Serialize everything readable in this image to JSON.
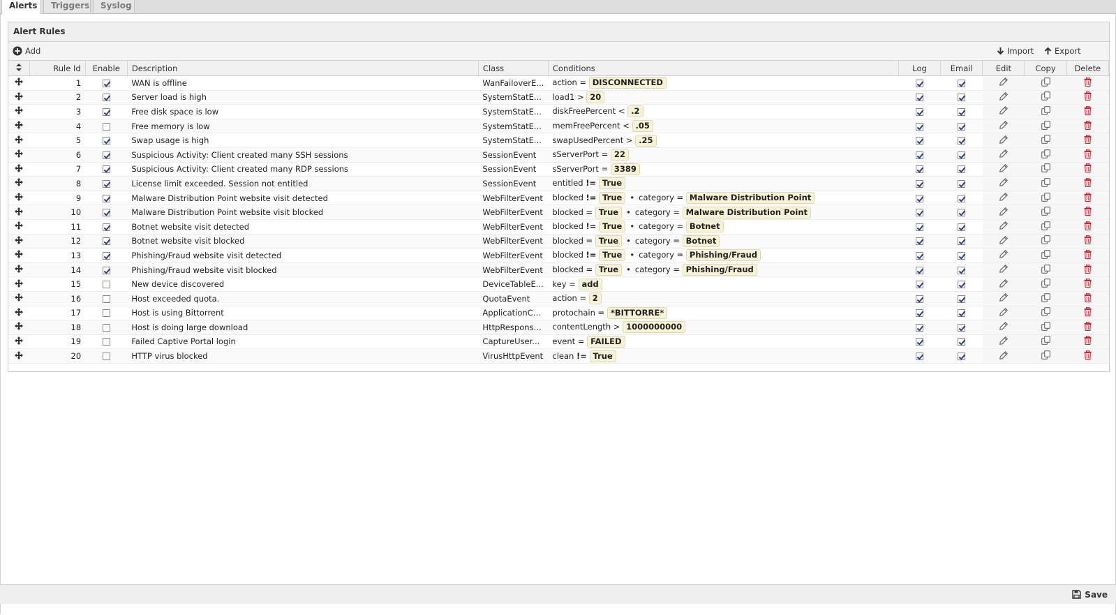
{
  "tabs": [
    {
      "label": "Alerts",
      "active": true
    },
    {
      "label": "Triggers",
      "active": false
    },
    {
      "label": "Syslog",
      "active": false
    }
  ],
  "panel": {
    "title": "Alert Rules"
  },
  "toolbar": {
    "add_label": "Add",
    "import_label": "Import",
    "export_label": "Export"
  },
  "columns": [
    "Rule Id",
    "Enable",
    "Description",
    "Class",
    "Conditions",
    "Log",
    "Email",
    "Edit",
    "Copy",
    "Delete"
  ],
  "rows": [
    {
      "id": "1",
      "enable": true,
      "description": "WAN is offline",
      "class": "WanFailoverE...",
      "conditions": [
        {
          "field": "action",
          "op": "=",
          "value": "DISCONNECTED"
        }
      ],
      "log": true,
      "email": true
    },
    {
      "id": "2",
      "enable": true,
      "description": "Server load is high",
      "class": "SystemStatE...",
      "conditions": [
        {
          "field": "load1",
          "op": ">",
          "value": "20"
        }
      ],
      "log": true,
      "email": true
    },
    {
      "id": "3",
      "enable": true,
      "description": "Free disk space is low",
      "class": "SystemStatE...",
      "conditions": [
        {
          "field": "diskFreePercent",
          "op": "<",
          "value": ".2"
        }
      ],
      "log": true,
      "email": true
    },
    {
      "id": "4",
      "enable": false,
      "description": "Free memory is low",
      "class": "SystemStatE...",
      "conditions": [
        {
          "field": "memFreePercent",
          "op": "<",
          "value": ".05"
        }
      ],
      "log": true,
      "email": true
    },
    {
      "id": "5",
      "enable": true,
      "description": "Swap usage is high",
      "class": "SystemStatE...",
      "conditions": [
        {
          "field": "swapUsedPercent",
          "op": ">",
          "value": ".25"
        }
      ],
      "log": true,
      "email": true
    },
    {
      "id": "6",
      "enable": true,
      "description": "Suspicious Activity: Client created many SSH sessions",
      "class": "SessionEvent",
      "conditions": [
        {
          "field": "sServerPort",
          "op": "=",
          "value": "22"
        }
      ],
      "log": true,
      "email": true
    },
    {
      "id": "7",
      "enable": true,
      "description": "Suspicious Activity: Client created many RDP sessions",
      "class": "SessionEvent",
      "conditions": [
        {
          "field": "sServerPort",
          "op": "=",
          "value": "3389"
        }
      ],
      "log": true,
      "email": true
    },
    {
      "id": "8",
      "enable": true,
      "description": "License limit exceeded. Session not entitled",
      "class": "SessionEvent",
      "conditions": [
        {
          "field": "entitled",
          "op": "!=",
          "value": "True"
        }
      ],
      "log": true,
      "email": true
    },
    {
      "id": "9",
      "enable": true,
      "description": "Malware Distribution Point website visit detected",
      "class": "WebFilterEvent",
      "conditions": [
        {
          "field": "blocked",
          "op": "!=",
          "value": "True"
        },
        {
          "field": "category",
          "op": "=",
          "value": "Malware Distribution Point"
        }
      ],
      "log": true,
      "email": true
    },
    {
      "id": "10",
      "enable": true,
      "description": "Malware Distribution Point website visit blocked",
      "class": "WebFilterEvent",
      "conditions": [
        {
          "field": "blocked",
          "op": "=",
          "value": "True"
        },
        {
          "field": "category",
          "op": "=",
          "value": "Malware Distribution Point"
        }
      ],
      "log": true,
      "email": true
    },
    {
      "id": "11",
      "enable": true,
      "description": "Botnet website visit detected",
      "class": "WebFilterEvent",
      "conditions": [
        {
          "field": "blocked",
          "op": "!=",
          "value": "True"
        },
        {
          "field": "category",
          "op": "=",
          "value": "Botnet"
        }
      ],
      "log": true,
      "email": true
    },
    {
      "id": "12",
      "enable": true,
      "description": "Botnet website visit blocked",
      "class": "WebFilterEvent",
      "conditions": [
        {
          "field": "blocked",
          "op": "=",
          "value": "True"
        },
        {
          "field": "category",
          "op": "=",
          "value": "Botnet"
        }
      ],
      "log": true,
      "email": true
    },
    {
      "id": "13",
      "enable": true,
      "description": "Phishing/Fraud website visit detected",
      "class": "WebFilterEvent",
      "conditions": [
        {
          "field": "blocked",
          "op": "!=",
          "value": "True"
        },
        {
          "field": "category",
          "op": "=",
          "value": "Phishing/Fraud"
        }
      ],
      "log": true,
      "email": true
    },
    {
      "id": "14",
      "enable": true,
      "description": "Phishing/Fraud website visit blocked",
      "class": "WebFilterEvent",
      "conditions": [
        {
          "field": "blocked",
          "op": "=",
          "value": "True"
        },
        {
          "field": "category",
          "op": "=",
          "value": "Phishing/Fraud"
        }
      ],
      "log": true,
      "email": true
    },
    {
      "id": "15",
      "enable": false,
      "description": "New device discovered",
      "class": "DeviceTableE...",
      "conditions": [
        {
          "field": "key",
          "op": "=",
          "value": "add"
        }
      ],
      "log": true,
      "email": true
    },
    {
      "id": "16",
      "enable": false,
      "description": "Host exceeded quota.",
      "class": "QuotaEvent",
      "conditions": [
        {
          "field": "action",
          "op": "=",
          "value": "2"
        }
      ],
      "log": true,
      "email": true
    },
    {
      "id": "17",
      "enable": false,
      "description": "Host is using Bittorrent",
      "class": "ApplicationCo...",
      "conditions": [
        {
          "field": "protochain",
          "op": "=",
          "value": "*BITTORRE*"
        }
      ],
      "log": true,
      "email": true
    },
    {
      "id": "18",
      "enable": false,
      "description": "Host is doing large download",
      "class": "HttpRespons...",
      "conditions": [
        {
          "field": "contentLength",
          "op": ">",
          "value": "1000000000"
        }
      ],
      "log": true,
      "email": true
    },
    {
      "id": "19",
      "enable": false,
      "description": "Failed Captive Portal login",
      "class": "CaptureUser...",
      "conditions": [
        {
          "field": "event",
          "op": "=",
          "value": "FAILED"
        }
      ],
      "log": true,
      "email": true
    },
    {
      "id": "20",
      "enable": false,
      "description": "HTTP virus blocked",
      "class": "VirusHttpEvent",
      "conditions": [
        {
          "field": "clean",
          "op": "!=",
          "value": "True"
        }
      ],
      "log": true,
      "email": true
    }
  ],
  "footer": {
    "save_label": "Save"
  },
  "colors": {
    "delete_icon": "#d9232d",
    "pill_bg": "#f7f3d7",
    "check_mark": "#2b3f8f"
  }
}
